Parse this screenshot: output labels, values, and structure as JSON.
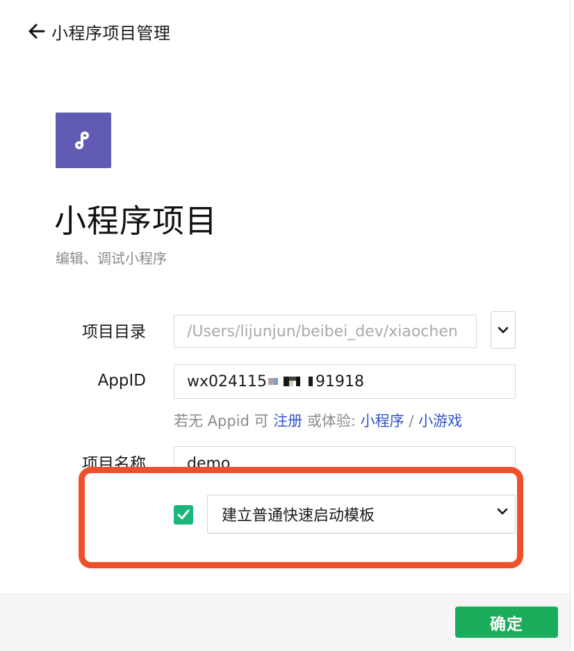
{
  "header": {
    "title": "小程序项目管理",
    "back_icon": "arrow-left-icon"
  },
  "logo": {
    "icon": "mini-program-logo-icon",
    "bg_color": "#625bb3"
  },
  "project": {
    "title": "小程序项目",
    "subtitle": "编辑、调试小程序"
  },
  "form": {
    "dir_label": "项目目录",
    "dir_value": "/Users/lijunjun/beibei_dev/xiaochen",
    "appid_label": "AppID",
    "appid_prefix": "wx024115",
    "appid_suffix": "91918",
    "hint_prefix": "若无 Appid 可 ",
    "hint_register": "注册",
    "hint_middle": " 或体验: ",
    "hint_mini_program": "小程序",
    "hint_sep": " / ",
    "hint_mini_game": "小游戏",
    "name_label": "项目名称",
    "name_value": "demo"
  },
  "template": {
    "checked": true,
    "selected": "建立普通快速启动模板"
  },
  "footer": {
    "confirm_label": "确定"
  },
  "colors": {
    "accent_green": "#1aad5b",
    "link_blue": "#2e54c8",
    "highlight_red": "#ee5129"
  }
}
